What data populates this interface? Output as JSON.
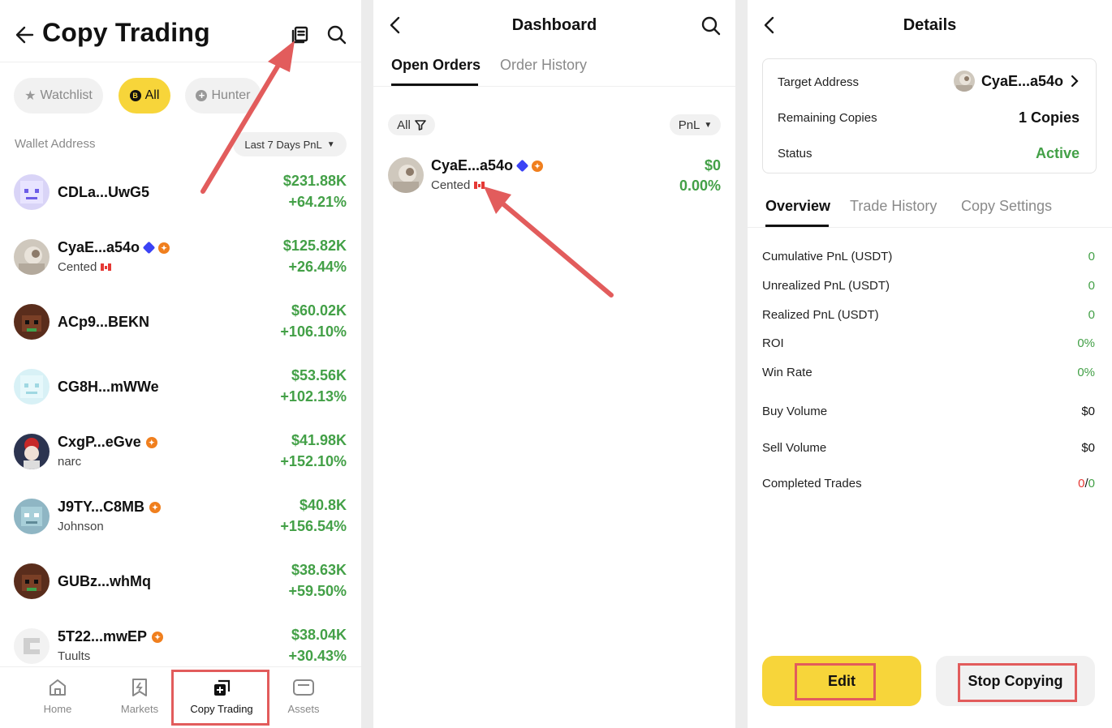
{
  "colors": {
    "accent_yellow": "#f7d53a",
    "profit_green": "#43a047",
    "loss_red": "#e53935",
    "annotation_red": "#e25c5c"
  },
  "panel1": {
    "title": "Copy Trading",
    "filters": [
      {
        "label": "Watchlist",
        "icon": "star-icon",
        "active": false
      },
      {
        "label": "All",
        "icon": "coin-icon",
        "active": true
      },
      {
        "label": "Hunter",
        "icon": "plus-circle-icon",
        "active": false
      }
    ],
    "list_header": "Wallet Address",
    "sort_label": "Last 7 Days PnL",
    "wallets": [
      {
        "name": "CDLa...UwG5",
        "sub": "",
        "pnl": "$231.88K",
        "pct": "+64.21%"
      },
      {
        "name": "CyaE...a54o",
        "sub": "Cented",
        "pnl": "$125.82K",
        "pct": "+26.44%"
      },
      {
        "name": "ACp9...BEKN",
        "sub": "",
        "pnl": "$60.02K",
        "pct": "+106.10%"
      },
      {
        "name": "CG8H...mWWe",
        "sub": "",
        "pnl": "$53.56K",
        "pct": "+102.13%"
      },
      {
        "name": "CxgP...eGve",
        "sub": "narc",
        "pnl": "$41.98K",
        "pct": "+152.10%"
      },
      {
        "name": "J9TY...C8MB",
        "sub": "Johnson",
        "pnl": "$40.8K",
        "pct": "+156.54%"
      },
      {
        "name": "GUBz...whMq",
        "sub": "",
        "pnl": "$38.63K",
        "pct": "+59.50%"
      },
      {
        "name": "5T22...mwEP",
        "sub": "Tuults",
        "pnl": "$38.04K",
        "pct": "+30.43%"
      }
    ],
    "nav": [
      {
        "label": "Home",
        "icon": "home-icon"
      },
      {
        "label": "Markets",
        "icon": "markets-icon"
      },
      {
        "label": "Copy Trading",
        "icon": "copy-trading-icon"
      },
      {
        "label": "Assets",
        "icon": "wallet-icon"
      }
    ]
  },
  "panel2": {
    "title": "Dashboard",
    "tabs": [
      "Open Orders",
      "Order History"
    ],
    "filter_all": "All",
    "sort": "PnL",
    "order": {
      "name": "CyaE...a54o",
      "sub": "Cented",
      "pnl": "$0",
      "pct": "0.00%"
    }
  },
  "panel3": {
    "title": "Details",
    "target_label": "Target Address",
    "target_value": "CyaE...a54o",
    "copies_label": "Remaining Copies",
    "copies_value": "1 Copies",
    "status_label": "Status",
    "status_value": "Active",
    "tabs": [
      "Overview",
      "Trade History",
      "Copy Settings"
    ],
    "stats": [
      {
        "label": "Cumulative PnL (USDT)",
        "value": "0"
      },
      {
        "label": "Unrealized PnL (USDT)",
        "value": "0"
      },
      {
        "label": "Realized PnL (USDT)",
        "value": "0"
      },
      {
        "label": "ROI",
        "value": "0%"
      },
      {
        "label": "Win Rate",
        "value": "0%"
      },
      {
        "label": "Buy Volume",
        "value": "$0"
      },
      {
        "label": "Sell Volume",
        "value": "$0"
      }
    ],
    "completed_label": "Completed Trades",
    "completed_win": "0",
    "completed_sep": "/",
    "completed_total": "0",
    "edit_label": "Edit",
    "stop_label": "Stop Copying"
  }
}
